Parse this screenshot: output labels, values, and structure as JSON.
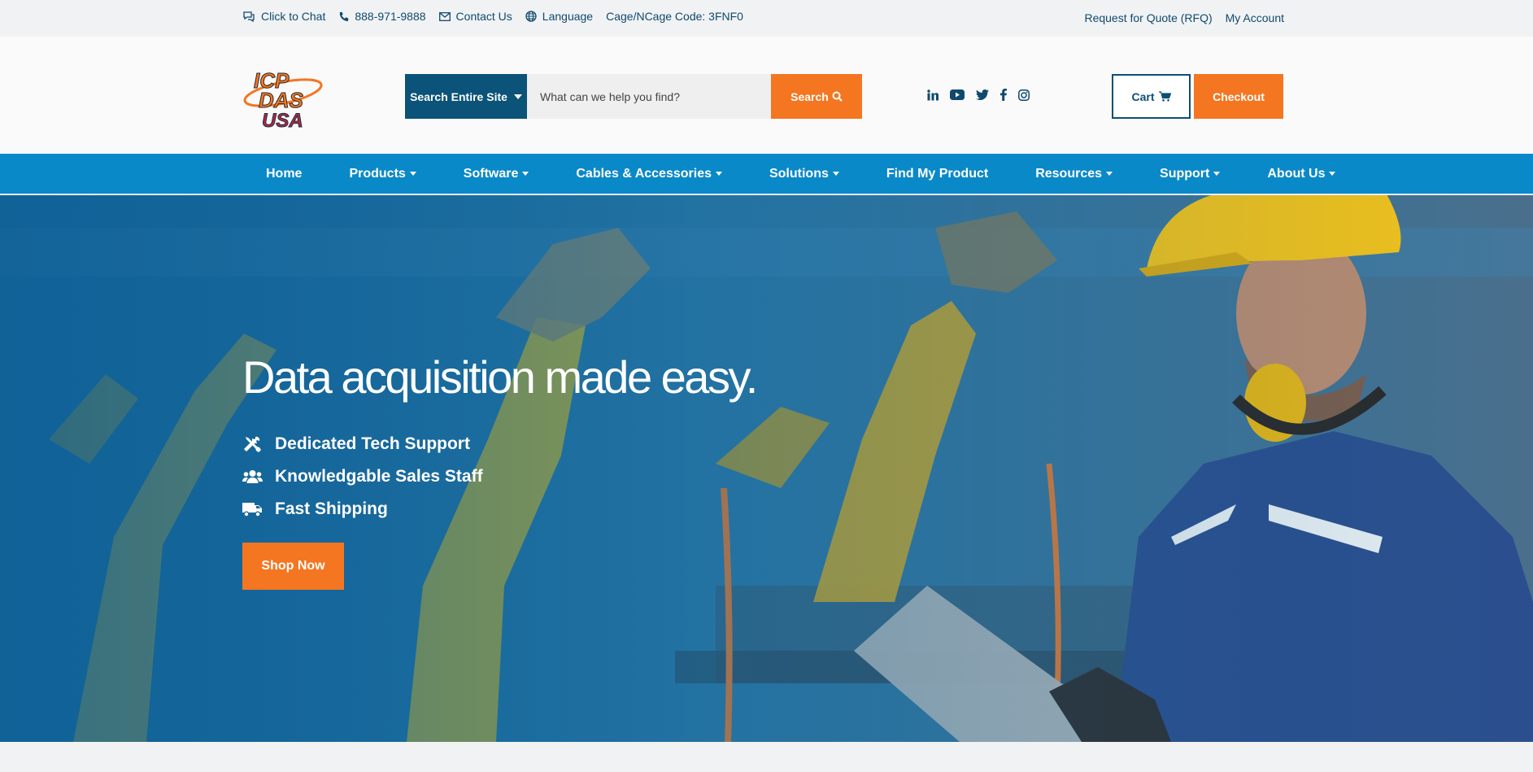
{
  "topbar": {
    "chat_label": "Click to Chat",
    "phone_label": "888-971-9888",
    "contact_label": "Contact Us",
    "language_label": "Language",
    "cage_label": "Cage/NCage Code: 3FNF0",
    "rfq_label": "Request for Quote (RFQ)",
    "account_label": "My Account"
  },
  "header": {
    "logo_text": "ICP DAS USA",
    "search_scope_label": "Search Entire Site",
    "search_placeholder": "What can we help you find?",
    "search_button_label": "Search",
    "social_icons": [
      "linkedin-icon",
      "youtube-icon",
      "twitter-icon",
      "facebook-icon",
      "instagram-icon"
    ],
    "cart_label": "Cart",
    "checkout_label": "Checkout"
  },
  "nav": {
    "items": [
      {
        "label": "Home",
        "dropdown": false
      },
      {
        "label": "Products",
        "dropdown": true
      },
      {
        "label": "Software",
        "dropdown": true
      },
      {
        "label": "Cables & Accessories",
        "dropdown": true
      },
      {
        "label": "Solutions",
        "dropdown": true
      },
      {
        "label": "Find My Product",
        "dropdown": false
      },
      {
        "label": "Resources",
        "dropdown": true
      },
      {
        "label": "Support",
        "dropdown": true
      },
      {
        "label": "About Us",
        "dropdown": true
      }
    ]
  },
  "hero": {
    "title": "Data acquisition made easy.",
    "features": [
      {
        "icon": "tools-icon",
        "label": "Dedicated Tech Support"
      },
      {
        "icon": "users-icon",
        "label": "Knowledgable Sales Staff"
      },
      {
        "icon": "truck-icon",
        "label": "Fast Shipping"
      }
    ],
    "cta_label": "Shop Now"
  },
  "colors": {
    "brand_dark": "#0b5378",
    "nav_blue": "#0a89c9",
    "accent_orange": "#f47621"
  }
}
